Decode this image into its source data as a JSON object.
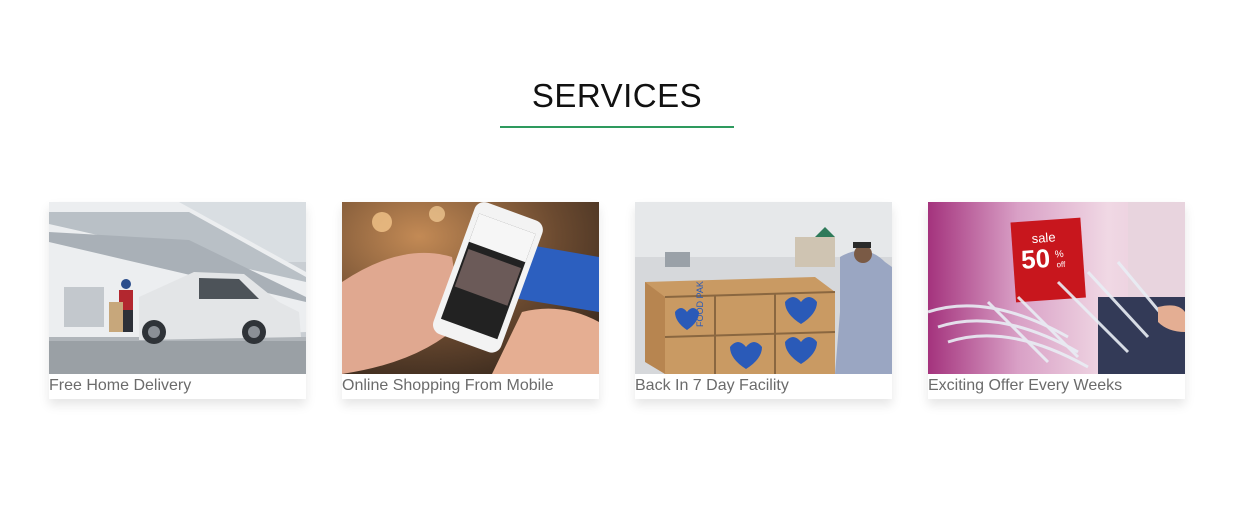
{
  "section": {
    "title": "SERVICES",
    "accent_color": "#2e9a5e"
  },
  "services": [
    {
      "label": "Free Home Delivery",
      "image_icon": "delivery-van-photo"
    },
    {
      "label": "Online Shopping From Mobile",
      "image_icon": "mobile-shopping-photo"
    },
    {
      "label": "Back In 7 Day Facility",
      "image_icon": "food-boxes-photo"
    },
    {
      "label": "Exciting Offer Every Weeks",
      "image_icon": "sale-offer-photo"
    }
  ],
  "sale_tag": {
    "line1": "sale",
    "line2": "50",
    "suffix": "%",
    "off": "off"
  },
  "box_text": "FOOD PAK"
}
